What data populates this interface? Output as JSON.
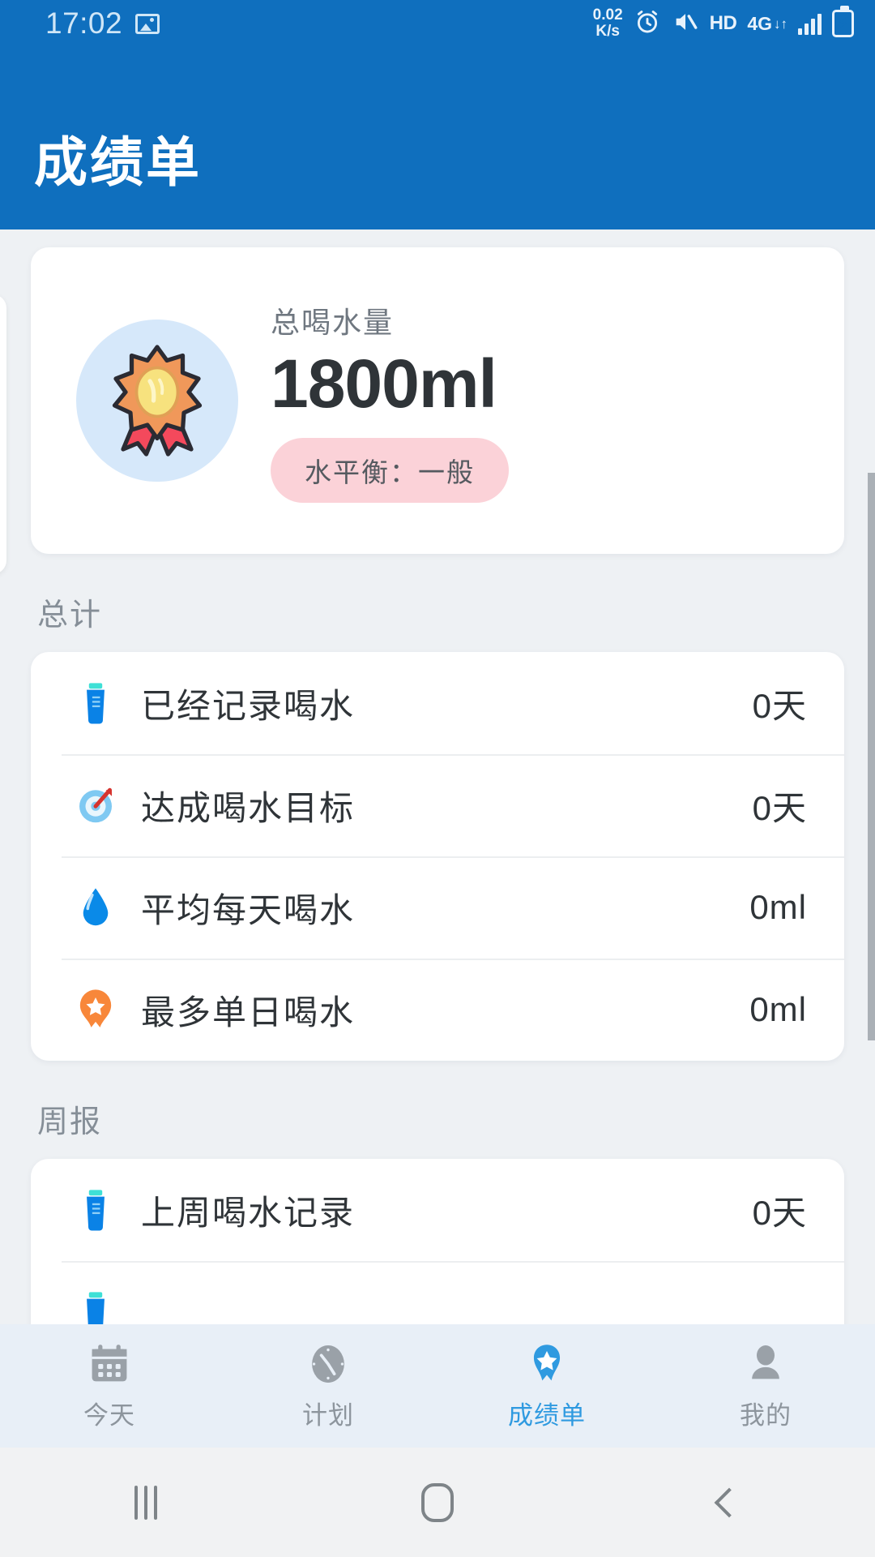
{
  "status_bar": {
    "time": "17:02",
    "photo_icon": "photo-icon",
    "network_speed": "0.02",
    "network_speed_unit": "K/s",
    "alarm_icon": "alarm-icon",
    "mute_icon": "mute-icon",
    "hd_label": "HD",
    "network_type": "4G",
    "signal_icon": "signal-bars-icon",
    "battery_icon": "battery-charging-icon",
    "background_color": "#0f6fbe"
  },
  "header": {
    "title": "成绩单",
    "background_color": "#0f6fbe",
    "text_color": "#ffffff"
  },
  "hero": {
    "medal_icon": "medal-sun-icon",
    "label": "总喝水量",
    "value": "1800ml",
    "badge": "水平衡：一般",
    "badge_bg": "#fbd2d8"
  },
  "sections": [
    {
      "title": "总计",
      "rows": [
        {
          "icon": "water-bottle-icon",
          "label": "已经记录喝水",
          "value": "0天"
        },
        {
          "icon": "target-dart-icon",
          "label": "达成喝水目标",
          "value": "0天"
        },
        {
          "icon": "water-drop-icon",
          "label": "平均每天喝水",
          "value": "0ml"
        },
        {
          "icon": "star-ribbon-icon",
          "label": "最多单日喝水",
          "value": "0ml"
        }
      ]
    },
    {
      "title": "周报",
      "rows": [
        {
          "icon": "water-bottle-icon",
          "label": "上周喝水记录",
          "value": "0天"
        }
      ]
    }
  ],
  "tabbar": {
    "active_color": "#2f9ae0",
    "inactive_color": "#8d959d",
    "items": [
      {
        "icon": "calendar-icon",
        "label": "今天",
        "active": false
      },
      {
        "icon": "clock-icon",
        "label": "计划",
        "active": false
      },
      {
        "icon": "badge-star-icon",
        "label": "成绩单",
        "active": true
      },
      {
        "icon": "person-icon",
        "label": "我的",
        "active": false
      }
    ]
  },
  "system_nav": {
    "recents_icon": "recents-icon",
    "home_icon": "home-icon",
    "back_icon": "back-icon"
  }
}
